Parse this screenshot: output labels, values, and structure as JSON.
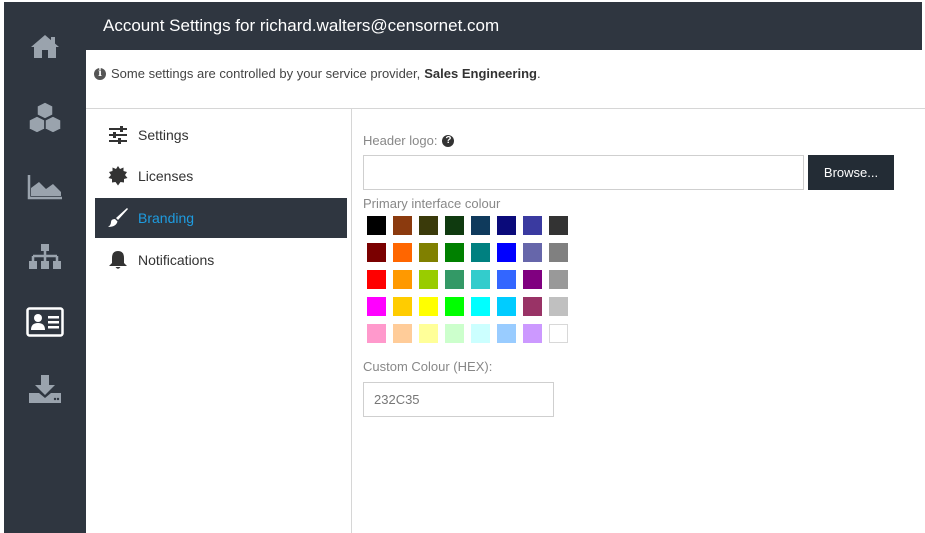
{
  "header": {
    "title": "Account Settings for richard.walters@censornet.com"
  },
  "notice": {
    "text": "Some settings are controlled by your service provider,",
    "provider": "Sales Engineering",
    "suffix": "."
  },
  "rail": {
    "items": [
      {
        "icon": "home-icon"
      },
      {
        "icon": "cubes-icon"
      },
      {
        "icon": "area-chart-icon"
      },
      {
        "icon": "sitemap-icon"
      },
      {
        "icon": "id-card-icon",
        "active": true
      },
      {
        "icon": "download-icon"
      }
    ]
  },
  "nav": {
    "items": [
      {
        "label": "Settings",
        "icon": "sliders-icon"
      },
      {
        "label": "Licenses",
        "icon": "certificate-icon"
      },
      {
        "label": "Branding",
        "icon": "paintbrush-icon",
        "active": true
      },
      {
        "label": "Notifications",
        "icon": "bell-icon"
      }
    ]
  },
  "branding": {
    "logo_label": "Header logo:",
    "logo_value": "",
    "browse_label": "Browse...",
    "colour_label": "Primary interface colour",
    "swatches": [
      [
        "#000000",
        "#8b3a0e",
        "#3a3a0a",
        "#0f3a0f",
        "#0f3a5c",
        "#0a0a7a",
        "#3a3aa0",
        "#333333"
      ],
      [
        "#7a0000",
        "#ff6600",
        "#808000",
        "#008000",
        "#008080",
        "#0000ff",
        "#6666aa",
        "#808080"
      ],
      [
        "#ff0000",
        "#ff9900",
        "#99cc00",
        "#339966",
        "#33cccc",
        "#3366ff",
        "#800080",
        "#999999"
      ],
      [
        "#ff00ff",
        "#ffcc00",
        "#ffff00",
        "#00ff00",
        "#00ffff",
        "#00ccff",
        "#993366",
        "#c0c0c0"
      ],
      [
        "#ff99cc",
        "#ffcc99",
        "#ffff99",
        "#ccffcc",
        "#ccffff",
        "#99ccff",
        "#cc99ff",
        "#ffffff"
      ]
    ],
    "hex_label": "Custom Colour (HEX):",
    "hex_value": "232C35"
  },
  "colors": {
    "dark": "#2f3640",
    "accent": "#1e9ce0",
    "button": "#232c35"
  }
}
